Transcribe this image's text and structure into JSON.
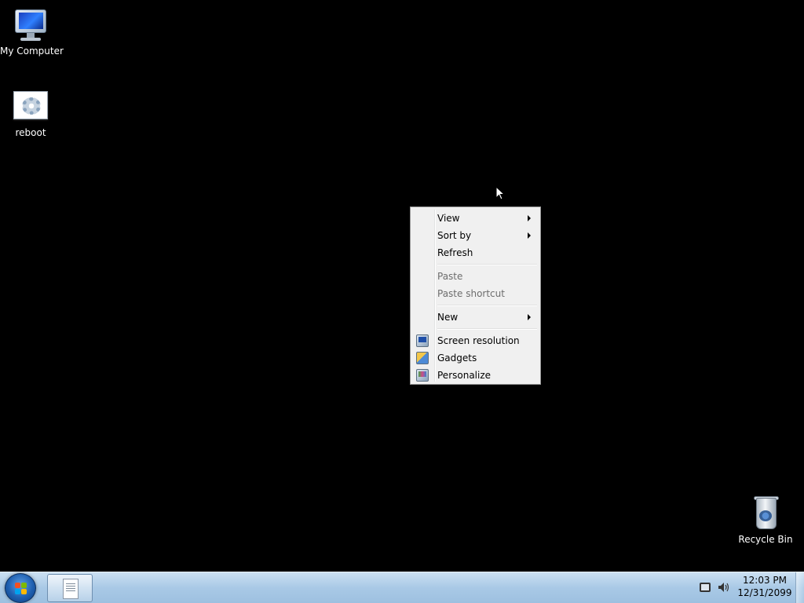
{
  "desktop": {
    "icons": [
      {
        "label": "My Computer",
        "icon": "computer-icon"
      },
      {
        "label": "reboot",
        "icon": "shortcut-settings-icon"
      },
      {
        "label": "Recycle Bin",
        "icon": "recycle-bin-icon"
      }
    ]
  },
  "context_menu": {
    "items": [
      {
        "label": "View",
        "submenu": true,
        "enabled": true
      },
      {
        "label": "Sort by",
        "submenu": true,
        "enabled": true
      },
      {
        "label": "Refresh",
        "submenu": false,
        "enabled": true
      },
      {
        "separator": true
      },
      {
        "label": "Paste",
        "submenu": false,
        "enabled": false
      },
      {
        "label": "Paste shortcut",
        "submenu": false,
        "enabled": false
      },
      {
        "separator": true
      },
      {
        "label": "New",
        "submenu": true,
        "enabled": true
      },
      {
        "separator": true
      },
      {
        "label": "Screen resolution",
        "icon": "screen-resolution-icon",
        "enabled": true
      },
      {
        "label": "Gadgets",
        "icon": "gadgets-icon",
        "enabled": true
      },
      {
        "label": "Personalize",
        "icon": "personalize-icon",
        "enabled": true
      }
    ]
  },
  "taskbar": {
    "start_icon": "windows-logo-icon",
    "pinned": [
      {
        "icon": "document-app-icon"
      }
    ],
    "tray": {
      "icons": [
        "network-icon",
        "volume-icon"
      ],
      "time": "12:03 PM",
      "date": "12/31/2099"
    }
  }
}
